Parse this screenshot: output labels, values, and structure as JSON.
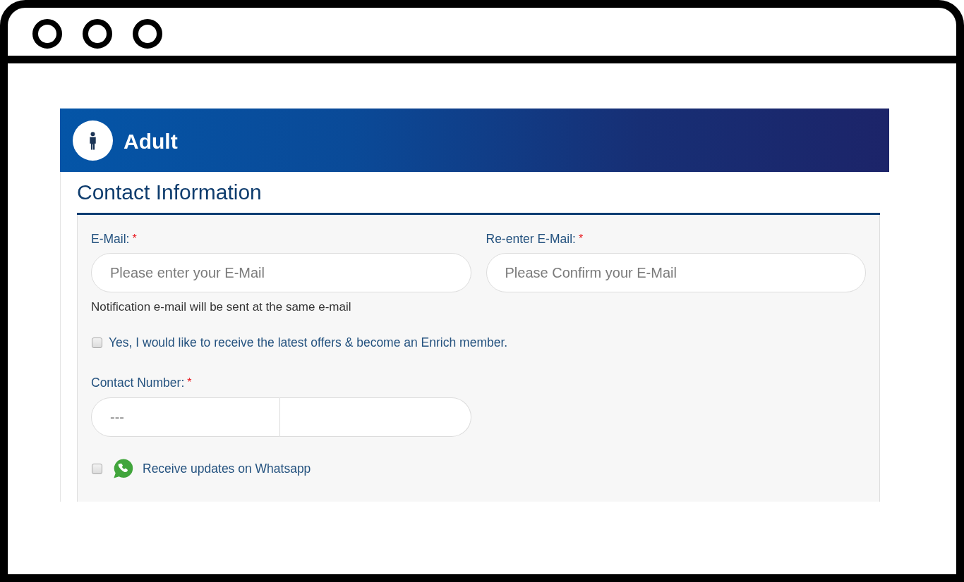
{
  "header": {
    "title": "Adult"
  },
  "section": {
    "title": "Contact Information"
  },
  "form": {
    "email_fields": [
      {
        "label": "E-Mail:",
        "required_mark": "*",
        "placeholder": "Please enter your E-Mail"
      },
      {
        "label": "Re-enter E-Mail:",
        "required_mark": "*",
        "placeholder": "Please Confirm your E-Mail"
      }
    ],
    "email_note": "Notification e-mail will be sent at the same e-mail",
    "offers_option": {
      "label": "Yes, I would like to receive the latest offers & become an Enrich member.",
      "checked": false
    },
    "contact_number": {
      "label": "Contact Number:",
      "required_mark": "*",
      "code_placeholder": "---"
    },
    "whatsapp_option": {
      "label": "Receive updates on Whatsapp",
      "checked": false
    }
  }
}
